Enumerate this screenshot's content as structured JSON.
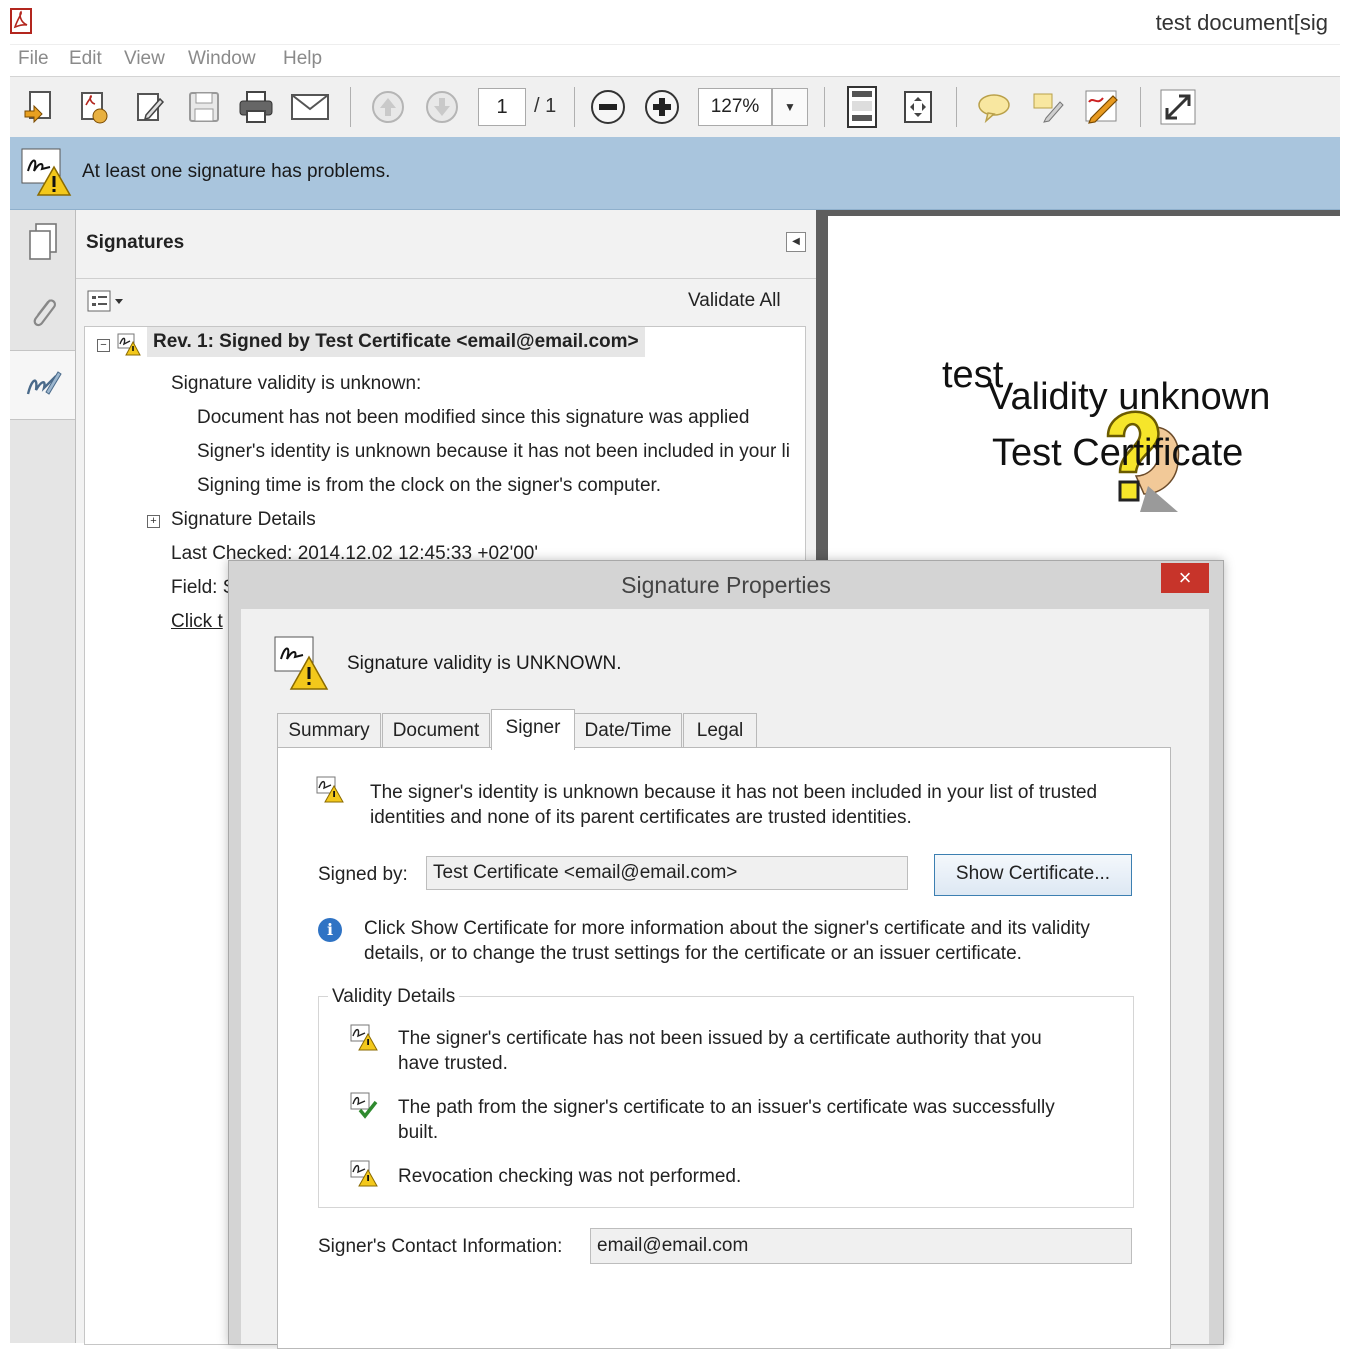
{
  "window": {
    "title": "test document[sig"
  },
  "menu": {
    "items": [
      "File",
      "Edit",
      "View",
      "Window",
      "Help"
    ]
  },
  "toolbar": {
    "page_current": "1",
    "page_total": "/ 1",
    "zoom": "127%"
  },
  "message_bar": {
    "text": "At least one signature has problems."
  },
  "signatures_panel": {
    "title": "Signatures",
    "validate_all": "Validate All",
    "rev_title": "Rev. 1: Signed by Test Certificate <email@email.com>",
    "validity": "Signature validity is unknown:",
    "details": [
      "Document has not been modified since this signature was applied",
      "Signer's identity is unknown because it has not been included in your li",
      "Signing time is from the clock on the signer's computer."
    ],
    "signature_details": "Signature Details",
    "last_checked": "Last Checked: 2014.12.02 12:45:33 +02'00'",
    "field": "Field: S",
    "click": "Click t"
  },
  "document": {
    "stamp_test": "test",
    "stamp_validity": "Validity unknown",
    "stamp_cert": "Test Certificate"
  },
  "dialog": {
    "title": "Signature Properties",
    "close": "×",
    "status": "Signature validity is UNKNOWN.",
    "tabs": [
      "Summary",
      "Document",
      "Signer",
      "Date/Time",
      "Legal"
    ],
    "identity_text_1": "The signer's identity is unknown because it has not been included in your list of trusted",
    "identity_text_2": "identities and none of its parent certificates are trusted identities.",
    "signed_by_label": "Signed by:",
    "signed_by_value": "Test Certificate <email@email.com>",
    "show_certificate": "Show Certificate...",
    "info_text_1": "Click Show Certificate for more information about the signer's certificate and its validity",
    "info_text_2": "details, or to change the trust settings for the certificate or an issuer certificate.",
    "validity_legend": "Validity Details",
    "validity_items": [
      {
        "line1": "The signer's certificate has not been issued by a certificate authority that you",
        "line2": "have trusted."
      },
      {
        "line1": "The path from the signer's certificate to an issuer's certificate was successfully",
        "line2": "built."
      },
      {
        "line1": "Revocation checking was not performed.",
        "line2": ""
      }
    ],
    "contact_label": "Signer's Contact Information:",
    "contact_value": "email@email.com"
  },
  "colors": {
    "message_bar": "#a9c5dd",
    "close_button": "#c7342a",
    "warning": "#f3c81b",
    "info": "#2f73c4"
  }
}
